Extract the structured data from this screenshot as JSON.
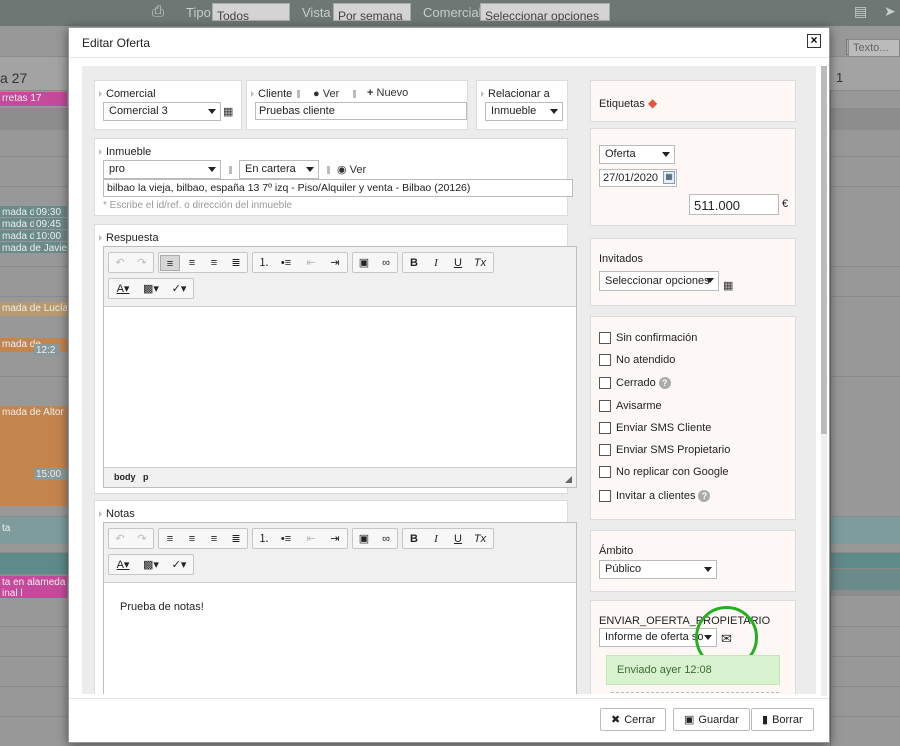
{
  "background": {
    "toolbar": {
      "tipo_label": "Tipo",
      "tipo_value": "Todos",
      "vista_label": "Vista",
      "vista_value": "Por semana",
      "comercial_label": "Comercial",
      "comercial_value": "Seleccionar opciones",
      "search_placeholder": "Texto..."
    },
    "day_label": "a 27",
    "col_label": "1",
    "events": [
      "rretas 17",
      "mada d",
      "09:30",
      "mada d",
      "09:45",
      "mada d",
      "10:00",
      "mada de Javier",
      "mada de Lucía",
      "mada de",
      "12:2",
      "mada de Altor L",
      "15:00",
      "ta",
      "ta en alameda d",
      "inal l"
    ]
  },
  "modal": {
    "title": "Editar Oferta",
    "close": "×",
    "comercial": {
      "label": "Comercial",
      "value": "Comercial 3"
    },
    "cliente": {
      "label": "Cliente",
      "ver": "Ver",
      "nuevo": "Nuevo",
      "value": "Pruebas cliente"
    },
    "relacionar": {
      "label": "Relacionar a",
      "value": "Inmueble"
    },
    "inmueble": {
      "label": "Inmueble",
      "value": "pro",
      "estado": "En cartera",
      "ver": "Ver",
      "address": "bilbao la vieja, bilbao, españa 13  7º izq - Piso/Alquiler y venta - Bilbao (20126)",
      "hint": "* Escribe el id/ref. o dirección del inmueble"
    },
    "respuesta": {
      "label": "Respuesta",
      "status_body": "body",
      "status_p": "p",
      "content": ""
    },
    "notas": {
      "label": "Notas",
      "content": "Prueba de notas!"
    },
    "etiquetas": {
      "label": "Etiquetas"
    },
    "oferta": {
      "tipo": "Oferta",
      "fecha": "27/01/2020",
      "importe": "511.000",
      "moneda": "€"
    },
    "invitados": {
      "label": "Invitados",
      "value": "Seleccionar opciones"
    },
    "checks": [
      "Sin confirmación",
      "No atendido",
      "Cerrado",
      "Avisarme",
      "Enviar SMS Cliente",
      "Enviar SMS Propietario",
      "No replicar con Google",
      "Invitar a clientes"
    ],
    "ambito": {
      "label": "Ámbito",
      "value": "Público"
    },
    "enviar": {
      "label": "ENVIAR_OFERTA_PROPIETARIO",
      "value": "Informe de oferta so",
      "status": "Enviado ayer 12:08"
    },
    "footer": {
      "cerrar": "Cerrar",
      "guardar": "Guardar",
      "borrar": "Borrar"
    }
  },
  "colors": {
    "highlight_circle": "#22b11f",
    "pink_event": "#c64a9c",
    "orange_event": "#c3844e",
    "teal_row": "#5f8a8a"
  }
}
